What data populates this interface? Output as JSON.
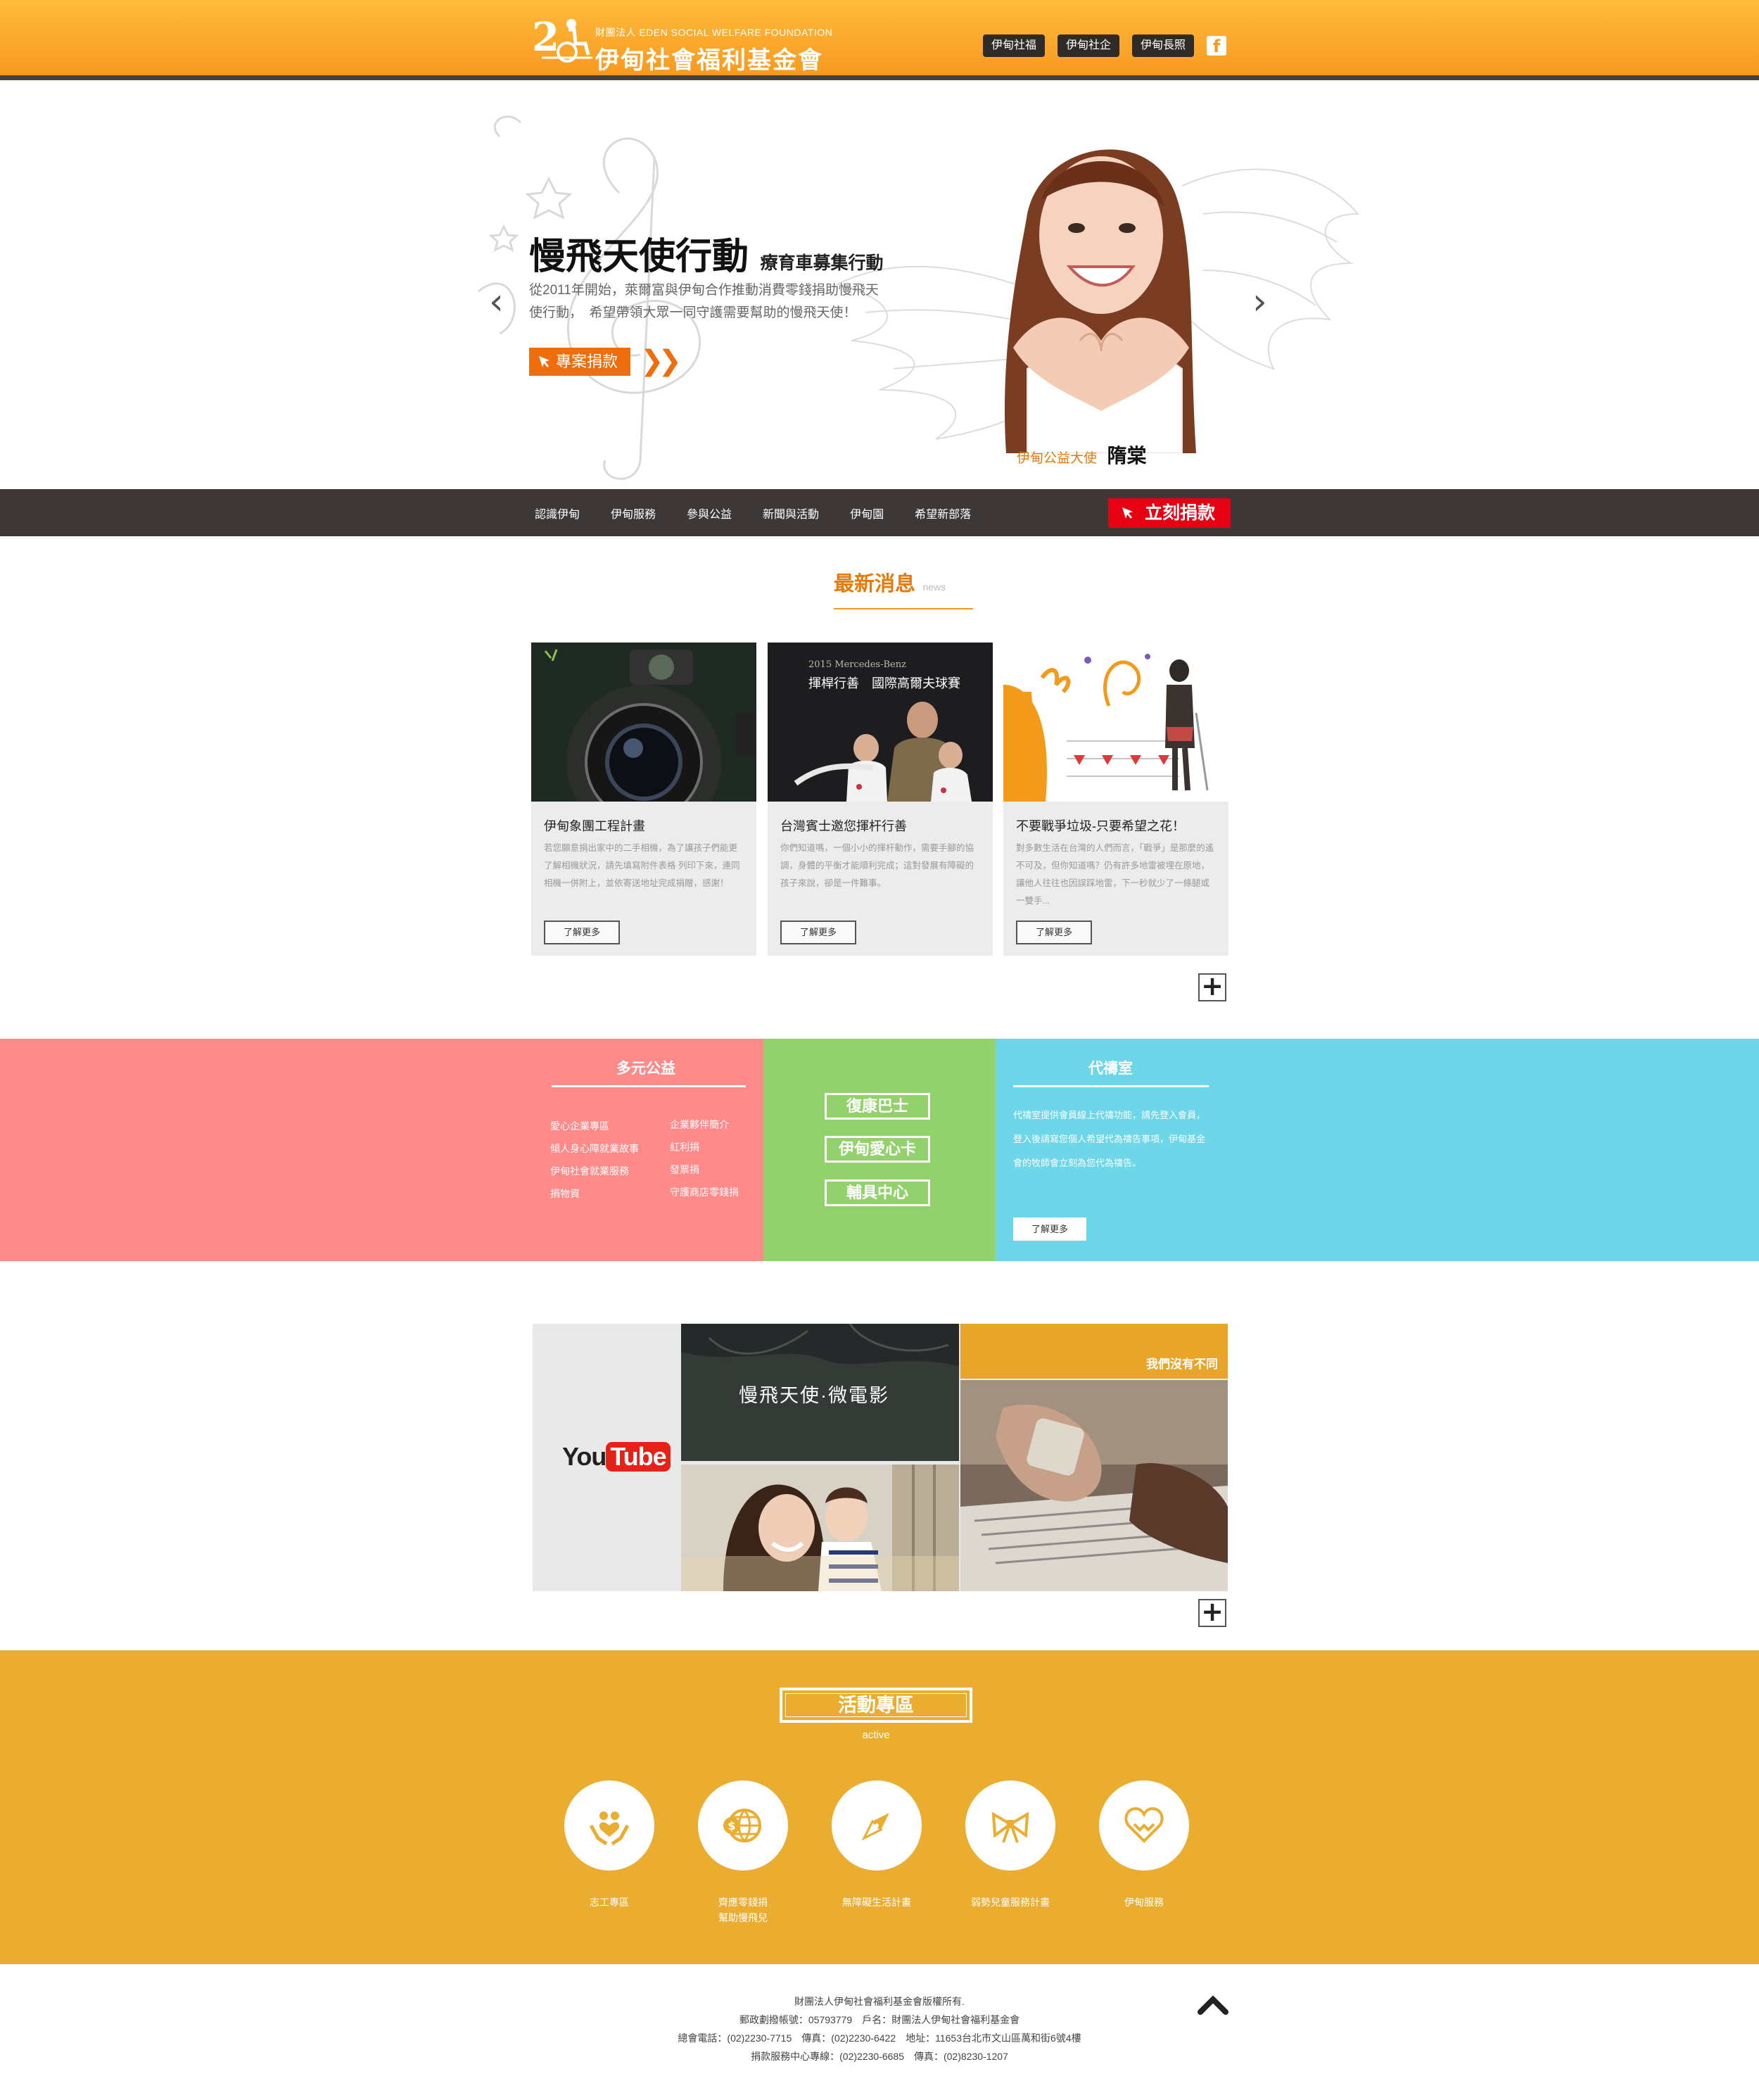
{
  "header": {
    "logo_sub": "財團法人 EDEN SOCIAL WELFARE FOUNDATION",
    "logo_main": "伊甸社會福利基金會",
    "links": [
      "伊甸社福",
      "伊甸社企",
      "伊甸長照"
    ],
    "facebook": "f"
  },
  "hero": {
    "title": "慢飛天使行動",
    "subtitle": "療育車募集行動",
    "description": "從2011年開始，萊爾富與伊甸合作推動消費零錢捐助慢飛天使行動，　希望帶領大眾一同守護需要幫助的慢飛天使！",
    "button": "專案捐款",
    "ambassador_label": "伊甸公益大使",
    "ambassador_name": "隋棠",
    "prev": "‹",
    "next": "›"
  },
  "nav": {
    "items": [
      "認識伊甸",
      "伊甸服務",
      "參與公益",
      "新聞與活動",
      "伊甸園",
      "希望新部落"
    ],
    "donate": "立刻捐款"
  },
  "news": {
    "title": "最新消息",
    "subtitle": "news",
    "cards": [
      {
        "title": "伊甸象團工程計畫",
        "text": "若您願意捐出家中的二手相機，為了讓孩子們能更了解相機狀況，請先填寫附件表格 列印下來，連同相機一併附上，並依寄送地址完成捐贈，感謝！",
        "button": "了解更多"
      },
      {
        "title": "台灣賓士邀您揮杆行善",
        "text": "你們知道嗎，一個小小的揮杆動作，需要手腳的協調，身體的平衡才能順利完成；這對發展有障礙的孩子來說，卻是一件難事。",
        "button": "了解更多",
        "image_caption_1": "2015 Mercedes-Benz",
        "image_caption_2": "揮桿行善　國際高爾夫球賽"
      },
      {
        "title": "不要戰爭垃圾-只要希望之花！",
        "text": "對多數生活在台灣的人們而言，「戰爭」是那麼的遙不可及，但你知道嗎？仍有許多地雷被埋在原地，讓他人往往也因誤踩地雷，下一秒就少了一條腿或一雙手...",
        "button": "了解更多"
      }
    ],
    "more": "+"
  },
  "band": {
    "pink_title": "多元公益",
    "pink_links_left": [
      "愛心企業專區",
      "傾人身心障就業故事",
      "伊甸社會就業服務",
      "捐物資"
    ],
    "pink_links_right": [
      "企業夥伴簡介",
      "紅利捐",
      "發票捐",
      "守護商店零錢捐"
    ],
    "green_buttons": [
      "復康巴士",
      "伊甸愛心卡",
      "輔具中心"
    ],
    "blue_title": "代禱室",
    "blue_text": "代禱室提供會員線上代禱功能，請先登入會員，登入後請寫您個人希望代為禱告事項，伊甸基金會的牧師會立刻為您代為禱告。",
    "blue_button": "了解更多"
  },
  "video": {
    "youtube_you": "You",
    "youtube_tube": "Tube",
    "video1_title": "慢飛天使·微電影",
    "video3_title": "我們沒有不同",
    "more": "+"
  },
  "activities": {
    "title": "活動專區",
    "subtitle": "active",
    "items": [
      {
        "label": "志工專區",
        "icon": "hands-heart-icon"
      },
      {
        "label": "齊應零錢捐\n幫助慢飛兒",
        "icon": "coin-globe-icon"
      },
      {
        "label": "無障礙生活計畫",
        "icon": "compass-icon"
      },
      {
        "label": "弱勢兒童服務計畫",
        "icon": "bow-icon"
      },
      {
        "label": "伊甸服務",
        "icon": "heart-icon"
      }
    ]
  },
  "footer": {
    "lines": [
      "財團法人伊甸社會福利基金會版權所有.",
      "郵政劃撥帳號：05793779　戶名：財團法人伊甸社會福利基金會",
      "總會電話：(02)2230-7715　傳真：(02)2230-6422　地址：11653台北市文山區萬和街6號4樓",
      "捐款服務中心專線：(02)2230-6685　傳真：(02)8230-1207"
    ]
  },
  "colors": {
    "header_orange": "#f89a20",
    "accent_orange": "#ee6d0c",
    "donate_red": "#e50012",
    "band_pink": "#ff8a8a",
    "band_green": "#92d16c",
    "band_blue": "#6dd6e8",
    "activities_yellow": "#eaad30"
  }
}
